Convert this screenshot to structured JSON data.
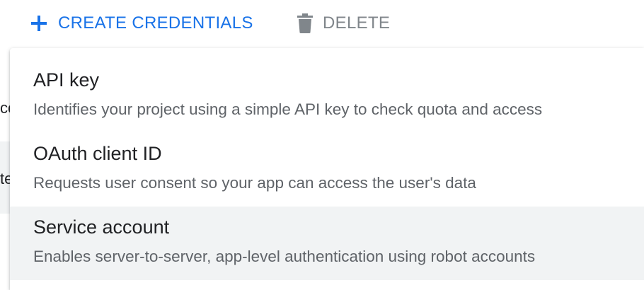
{
  "toolbar": {
    "create_label": "CREATE CREDENTIALS",
    "delete_label": "DELETE",
    "create_icon": "plus-icon",
    "delete_icon": "trash-icon",
    "accent_color": "#1a73e8",
    "disabled_color": "#80868b"
  },
  "background": {
    "fragment_1": "co",
    "fragment_2": "te"
  },
  "menu": {
    "items": [
      {
        "title": "API key",
        "description": "Identifies your project using a simple API key to check quota and access",
        "highlighted": false
      },
      {
        "title": "OAuth client ID",
        "description": "Requests user consent so your app can access the user's data",
        "highlighted": false
      },
      {
        "title": "Service account",
        "description": "Enables server-to-server, app-level authentication using robot accounts",
        "highlighted": true
      }
    ]
  }
}
